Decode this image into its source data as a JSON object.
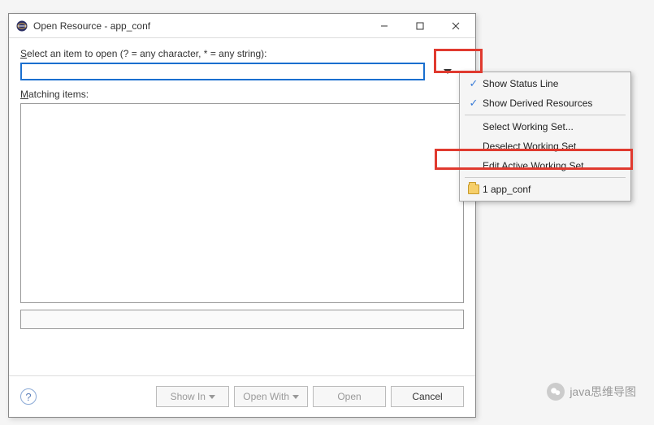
{
  "dialog": {
    "title": "Open Resource - app_conf",
    "select_label_pre": "S",
    "select_label_rest": "elect an item to open (? = any character, * = any string):",
    "matching_label_pre": "M",
    "matching_label_rest": "atching items:",
    "search_value": ""
  },
  "buttons": {
    "show_in": "Show In",
    "open_with": "Open With",
    "open": "Open",
    "cancel": "Cancel"
  },
  "menu": {
    "status_line": "Show Status Line",
    "derived": "Show Derived Resources",
    "select_ws": "Select Working Set...",
    "deselect_ws": "Deselect Working Set",
    "edit_ws": "Edit Active Working Set...",
    "recent": "1 app_conf"
  },
  "credit": "java思维导图"
}
